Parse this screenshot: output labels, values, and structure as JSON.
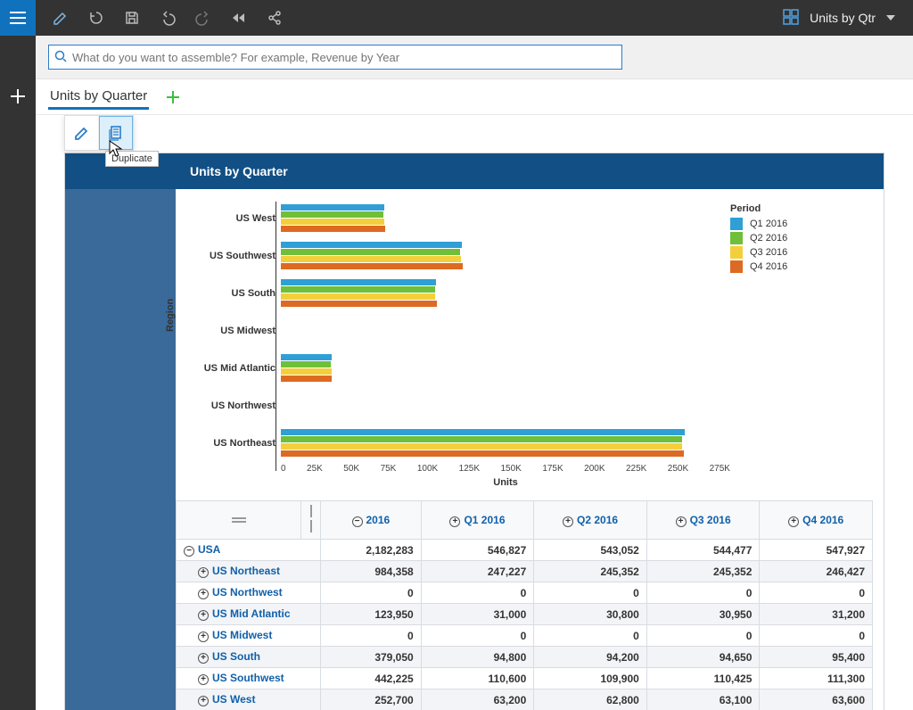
{
  "topbar": {
    "view_label": "Units by Qtr"
  },
  "search": {
    "placeholder": "What do you want to assemble? For example, Revenue by Year"
  },
  "tab": {
    "label": "Units by Quarter"
  },
  "popover": {
    "tooltip": "Duplicate"
  },
  "card": {
    "title": "Units by Quarter"
  },
  "legend": {
    "title": "Period",
    "items": [
      "Q1 2016",
      "Q2 2016",
      "Q3 2016",
      "Q4 2016"
    ]
  },
  "colors": {
    "q1": "#2f9fd6",
    "q2": "#6fbf3a",
    "q3": "#f4cf3c",
    "q4": "#dd6a22"
  },
  "axis": {
    "xlabel": "Units",
    "ylabel": "Region"
  },
  "ticks": [
    "0",
    "25K",
    "50K",
    "75K",
    "100K",
    "125K",
    "150K",
    "175K",
    "200K",
    "225K",
    "250K",
    "275K"
  ],
  "table": {
    "year": "2016",
    "cols": [
      "Q1 2016",
      "Q2 2016",
      "Q3 2016",
      "Q4 2016"
    ],
    "rows": [
      {
        "label": "USA",
        "total": "2,182,283",
        "v": [
          "546,827",
          "543,052",
          "544,477",
          "547,927"
        ],
        "indent": 0,
        "expand": "-"
      },
      {
        "label": "US Northeast",
        "total": "984,358",
        "v": [
          "247,227",
          "245,352",
          "245,352",
          "246,427"
        ],
        "indent": 1,
        "expand": "+"
      },
      {
        "label": "US Northwest",
        "total": "0",
        "v": [
          "0",
          "0",
          "0",
          "0"
        ],
        "indent": 1,
        "expand": "+"
      },
      {
        "label": "US Mid Atlantic",
        "total": "123,950",
        "v": [
          "31,000",
          "30,800",
          "30,950",
          "31,200"
        ],
        "indent": 1,
        "expand": "+"
      },
      {
        "label": "US Midwest",
        "total": "0",
        "v": [
          "0",
          "0",
          "0",
          "0"
        ],
        "indent": 1,
        "expand": "+"
      },
      {
        "label": "US South",
        "total": "379,050",
        "v": [
          "94,800",
          "94,200",
          "94,650",
          "95,400"
        ],
        "indent": 1,
        "expand": "+"
      },
      {
        "label": "US Southwest",
        "total": "442,225",
        "v": [
          "110,600",
          "109,900",
          "110,425",
          "111,300"
        ],
        "indent": 1,
        "expand": "+"
      },
      {
        "label": "US West",
        "total": "252,700",
        "v": [
          "63,200",
          "62,800",
          "63,100",
          "63,600"
        ],
        "indent": 1,
        "expand": "+"
      }
    ]
  },
  "chart_data": {
    "type": "bar",
    "orientation": "horizontal",
    "grouped": true,
    "title": "Units by Quarter",
    "xlabel": "Units",
    "ylabel": "Region",
    "xlim": [
      0,
      275000
    ],
    "xticks": [
      0,
      25000,
      50000,
      75000,
      100000,
      125000,
      150000,
      175000,
      200000,
      225000,
      250000,
      275000
    ],
    "categories": [
      "US West",
      "US Southwest",
      "US South",
      "US Midwest",
      "US Mid Atlantic",
      "US Northwest",
      "US Northeast"
    ],
    "series": [
      {
        "name": "Q1 2016",
        "color": "#2f9fd6",
        "values": [
          63200,
          110600,
          94800,
          0,
          31000,
          0,
          247227
        ]
      },
      {
        "name": "Q2 2016",
        "color": "#6fbf3a",
        "values": [
          62800,
          109900,
          94200,
          0,
          30800,
          0,
          245352
        ]
      },
      {
        "name": "Q3 2016",
        "color": "#f4cf3c",
        "values": [
          63100,
          110425,
          94650,
          0,
          30950,
          0,
          245352
        ]
      },
      {
        "name": "Q4 2016",
        "color": "#dd6a22",
        "values": [
          63600,
          111300,
          95400,
          0,
          31200,
          0,
          246427
        ]
      }
    ],
    "legend": {
      "title": "Period",
      "position": "right"
    }
  }
}
